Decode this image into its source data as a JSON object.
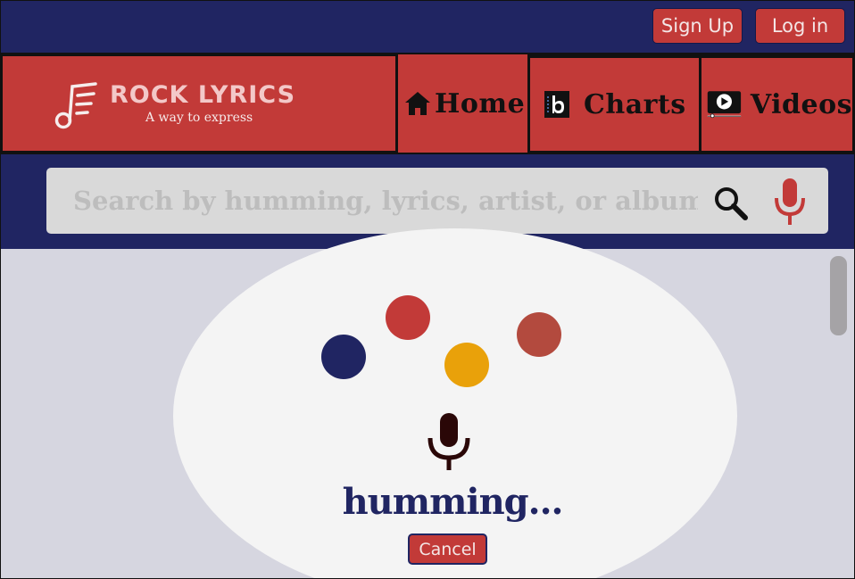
{
  "header": {
    "signup_label": "Sign Up",
    "login_label": "Log in"
  },
  "brand": {
    "title": "ROCK LYRICS",
    "subtitle": "A way to express",
    "logo_icon": "music-note-lines-icon"
  },
  "nav": {
    "items": [
      {
        "label": "Home",
        "icon": "home-icon"
      },
      {
        "label": "Charts",
        "icon": "billboard-icon"
      },
      {
        "label": "Videos",
        "icon": "video-play-icon"
      }
    ]
  },
  "search": {
    "placeholder": "Search by humming, lyrics, artist, or album",
    "value": ""
  },
  "listening": {
    "status": "humming...",
    "cancel_label": "Cancel"
  },
  "colors": {
    "navy": "#202562",
    "red": "#c23a38",
    "yellow": "#e9a10a",
    "brick": "#b34a3e",
    "background": "#d6d6e0"
  }
}
